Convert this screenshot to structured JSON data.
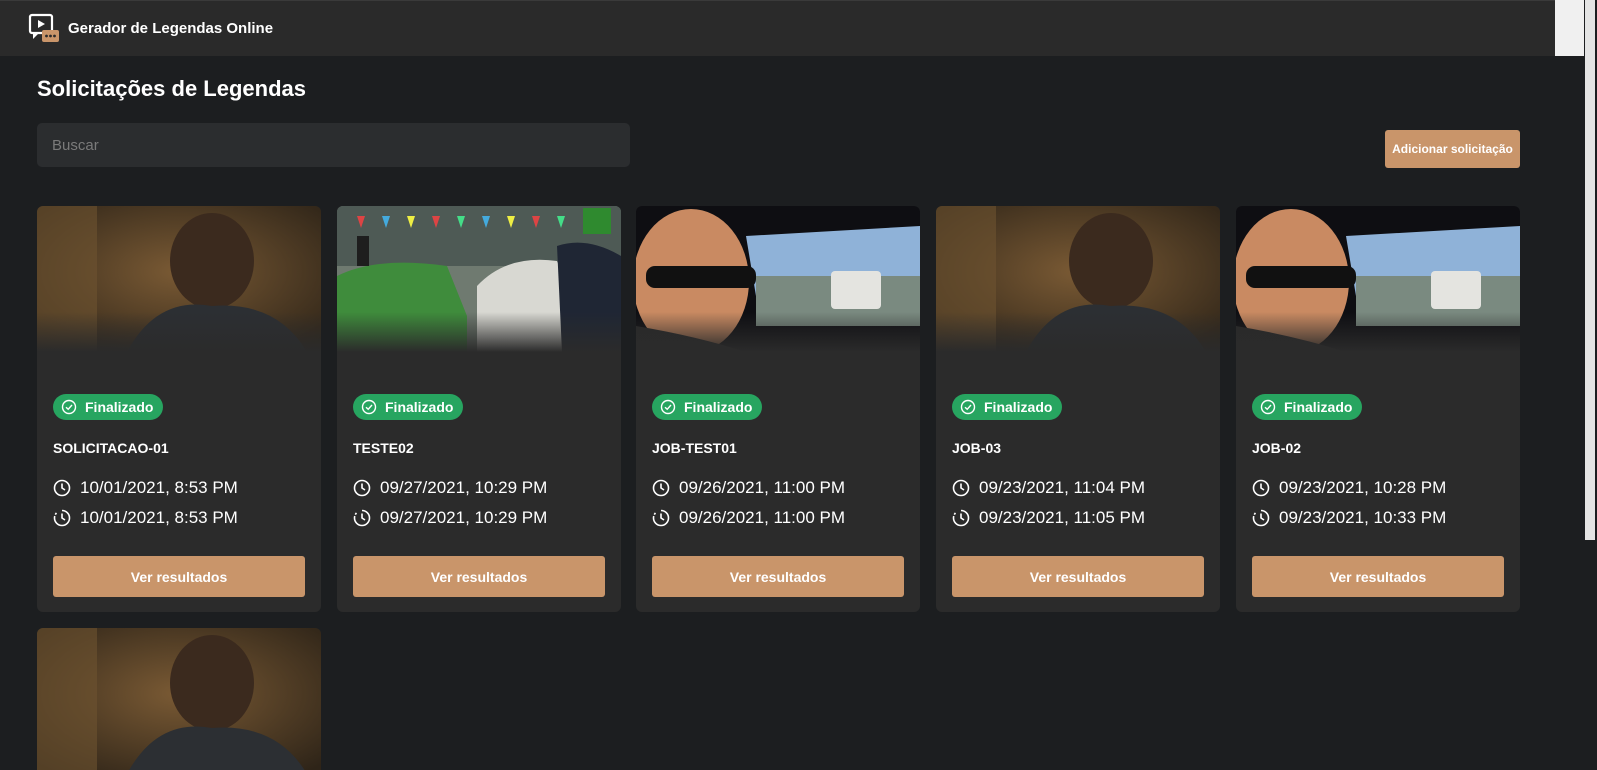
{
  "header": {
    "app_title": "Gerador de Legendas Online",
    "logo_icon": "subtitle-logo-icon"
  },
  "page": {
    "title": "Solicitações de Legendas"
  },
  "search": {
    "placeholder": "Buscar",
    "value": ""
  },
  "actions": {
    "add_label": "Adicionar solicitação"
  },
  "colors": {
    "accent": "#c9956a",
    "success": "#27a560",
    "background": "#1c1e20",
    "card": "#2b2b2b",
    "topbar": "#2a2a2a"
  },
  "cards": [
    {
      "name": "SOLICITACAO-01",
      "status": "Finalizado",
      "created": "10/01/2021, 8:53 PM",
      "updated": "10/01/2021, 8:53 PM",
      "button": "Ver resultados"
    },
    {
      "name": "TESTE02",
      "status": "Finalizado",
      "created": "09/27/2021, 10:29 PM",
      "updated": "09/27/2021, 10:29 PM",
      "button": "Ver resultados"
    },
    {
      "name": "JOB-TEST01",
      "status": "Finalizado",
      "created": "09/26/2021, 11:00 PM",
      "updated": "09/26/2021, 11:00 PM",
      "button": "Ver resultados"
    },
    {
      "name": "JOB-03",
      "status": "Finalizado",
      "created": "09/23/2021, 11:04 PM",
      "updated": "09/23/2021, 11:05 PM",
      "button": "Ver resultados"
    },
    {
      "name": "JOB-02",
      "status": "Finalizado",
      "created": "09/23/2021, 10:28 PM",
      "updated": "09/23/2021, 10:33 PM",
      "button": "Ver resultados"
    }
  ]
}
